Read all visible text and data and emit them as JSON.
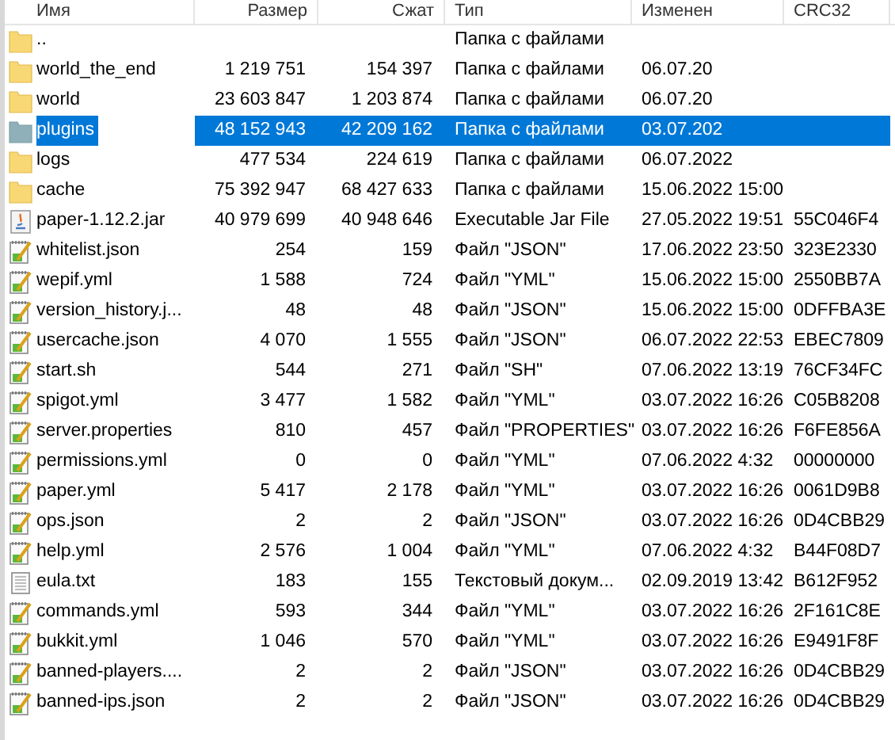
{
  "columns": [
    "Имя",
    "Размер",
    "Сжат",
    "Тип",
    "Изменен",
    "CRC32"
  ],
  "rows": [
    {
      "kind": "folder",
      "name": "..",
      "size": "",
      "packed": "",
      "type": "Папка с файлами",
      "modified": "",
      "crc": "",
      "selected": false
    },
    {
      "kind": "folder",
      "name": "world_the_end",
      "size": "1 219 751",
      "packed": "154 397",
      "type": "Папка с файлами",
      "modified": "06.07.20",
      "crc": "",
      "selected": false
    },
    {
      "kind": "folder",
      "name": "world",
      "size": "23 603 847",
      "packed": "1 203 874",
      "type": "Папка с файлами",
      "modified": "06.07.20",
      "crc": "",
      "selected": false
    },
    {
      "kind": "folder",
      "name": "plugins",
      "size": "48 152 943",
      "packed": "42 209 162",
      "type": "Папка с файлами",
      "modified": "03.07.202",
      "crc": "",
      "selected": true
    },
    {
      "kind": "folder",
      "name": "logs",
      "size": "477 534",
      "packed": "224 619",
      "type": "Папка с файлами",
      "modified": "06.07.2022",
      "crc": "",
      "selected": false
    },
    {
      "kind": "folder",
      "name": "cache",
      "size": "75 392 947",
      "packed": "68 427 633",
      "type": "Папка с файлами",
      "modified": "15.06.2022 15:00",
      "crc": "",
      "selected": false
    },
    {
      "kind": "jar",
      "name": "paper-1.12.2.jar",
      "size": "40 979 699",
      "packed": "40 948 646",
      "type": "Executable Jar File",
      "modified": "27.05.2022 19:51",
      "crc": "55C046F4",
      "selected": false
    },
    {
      "kind": "script",
      "name": "whitelist.json",
      "size": "254",
      "packed": "159",
      "type": "Файл \"JSON\"",
      "modified": "17.06.2022 23:50",
      "crc": "323E2330",
      "selected": false
    },
    {
      "kind": "script",
      "name": "wepif.yml",
      "size": "1 588",
      "packed": "724",
      "type": "Файл \"YML\"",
      "modified": "15.06.2022 15:00",
      "crc": "2550BB7A",
      "selected": false
    },
    {
      "kind": "script",
      "name": "version_history.j...",
      "size": "48",
      "packed": "48",
      "type": "Файл \"JSON\"",
      "modified": "15.06.2022 15:00",
      "crc": "0DFFBA3E",
      "selected": false
    },
    {
      "kind": "script",
      "name": "usercache.json",
      "size": "4 070",
      "packed": "1 555",
      "type": "Файл \"JSON\"",
      "modified": "06.07.2022 22:53",
      "crc": "EBEC7809",
      "selected": false
    },
    {
      "kind": "script",
      "name": "start.sh",
      "size": "544",
      "packed": "271",
      "type": "Файл \"SH\"",
      "modified": "07.06.2022 13:19",
      "crc": "76CF34FC",
      "selected": false
    },
    {
      "kind": "script",
      "name": "spigot.yml",
      "size": "3 477",
      "packed": "1 582",
      "type": "Файл \"YML\"",
      "modified": "03.07.2022 16:26",
      "crc": "C05B8208",
      "selected": false
    },
    {
      "kind": "script",
      "name": "server.properties",
      "size": "810",
      "packed": "457",
      "type": "Файл \"PROPERTIES\"",
      "modified": "03.07.2022 16:26",
      "crc": "F6FE856A",
      "selected": false
    },
    {
      "kind": "script",
      "name": "permissions.yml",
      "size": "0",
      "packed": "0",
      "type": "Файл \"YML\"",
      "modified": "07.06.2022 4:32",
      "crc": "00000000",
      "selected": false
    },
    {
      "kind": "script",
      "name": "paper.yml",
      "size": "5 417",
      "packed": "2 178",
      "type": "Файл \"YML\"",
      "modified": "03.07.2022 16:26",
      "crc": "0061D9B8",
      "selected": false
    },
    {
      "kind": "script",
      "name": "ops.json",
      "size": "2",
      "packed": "2",
      "type": "Файл \"JSON\"",
      "modified": "03.07.2022 16:26",
      "crc": "0D4CBB29",
      "selected": false
    },
    {
      "kind": "script",
      "name": "help.yml",
      "size": "2 576",
      "packed": "1 004",
      "type": "Файл \"YML\"",
      "modified": "07.06.2022 4:32",
      "crc": "B44F08D7",
      "selected": false
    },
    {
      "kind": "text",
      "name": "eula.txt",
      "size": "183",
      "packed": "155",
      "type": "Текстовый докум...",
      "modified": "02.09.2019 13:42",
      "crc": "B612F952",
      "selected": false
    },
    {
      "kind": "script",
      "name": "commands.yml",
      "size": "593",
      "packed": "344",
      "type": "Файл \"YML\"",
      "modified": "03.07.2022 16:26",
      "crc": "2F161C8E",
      "selected": false
    },
    {
      "kind": "script",
      "name": "bukkit.yml",
      "size": "1 046",
      "packed": "570",
      "type": "Файл \"YML\"",
      "modified": "03.07.2022 16:26",
      "crc": "E9491F8F",
      "selected": false
    },
    {
      "kind": "script",
      "name": "banned-players....",
      "size": "2",
      "packed": "2",
      "type": "Файл \"JSON\"",
      "modified": "03.07.2022 16:26",
      "crc": "0D4CBB29",
      "selected": false
    },
    {
      "kind": "script",
      "name": "banned-ips.json",
      "size": "2",
      "packed": "2",
      "type": "Файл \"JSON\"",
      "modified": "03.07.2022 16:26",
      "crc": "0D4CBB29",
      "selected": false
    }
  ]
}
